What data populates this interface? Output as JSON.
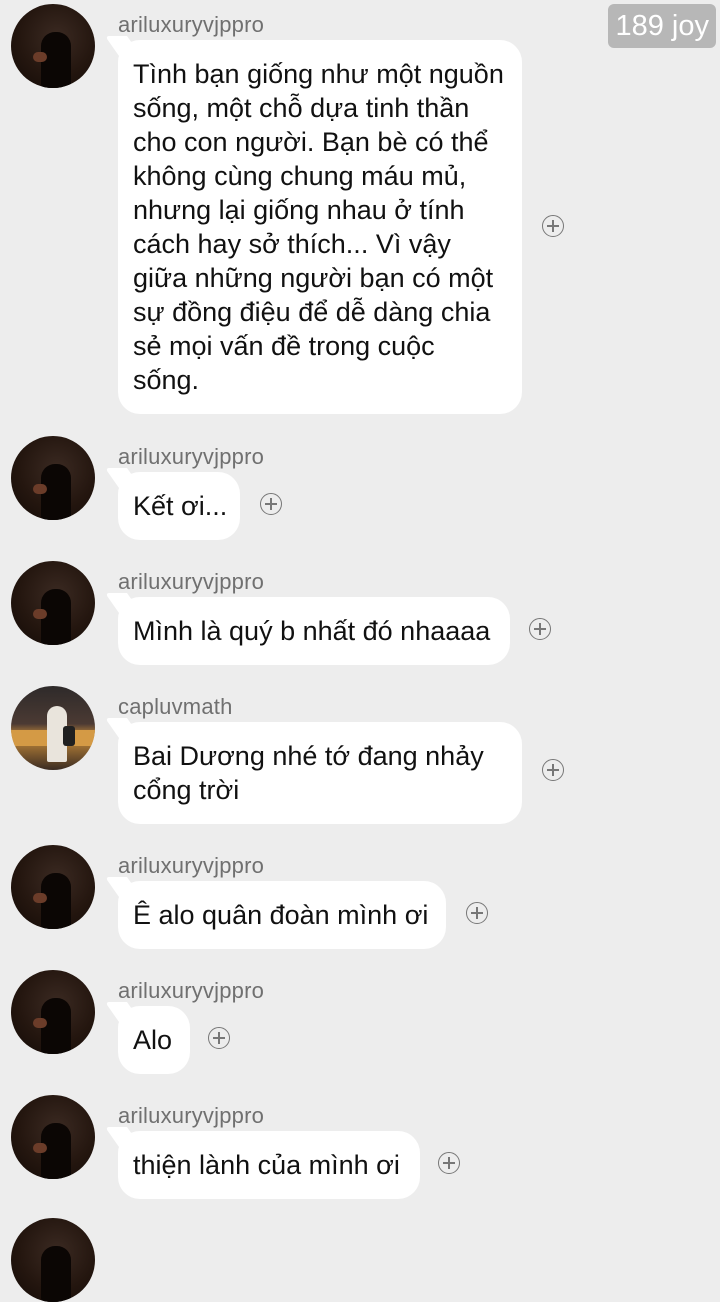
{
  "watermark": {
    "text": "189 joy"
  },
  "messages": [
    {
      "username": "ariluxuryvjppro",
      "avatar": "dark-portrait-avatar",
      "text": "Tình bạn giống như một nguồn sống, một chỗ dựa tinh thần cho con người. Bạn bè có thể không cùng chung máu mủ, nhưng lại giống nhau ở tính cách hay sở thích... Vì vậy giữa những người bạn có một sự đồng điệu để dễ dàng chia sẻ mọi vấn đề trong cuộc sống."
    },
    {
      "username": "ariluxuryvjppro",
      "avatar": "dark-portrait-avatar",
      "text": "Kết ơi..."
    },
    {
      "username": "ariluxuryvjppro",
      "avatar": "dark-portrait-avatar",
      "text": "Mình là quý b nhất đó nhaaaa"
    },
    {
      "username": "capluvmath",
      "avatar": "bakery-photo-avatar",
      "text": "Bai Dương nhé tớ đang nhảy cổng trời"
    },
    {
      "username": "ariluxuryvjppro",
      "avatar": "dark-portrait-avatar",
      "text": "Ê alo quân đoàn mình ơi"
    },
    {
      "username": "ariluxuryvjppro",
      "avatar": "dark-portrait-avatar",
      "text": "Alo"
    },
    {
      "username": "ariluxuryvjppro",
      "avatar": "dark-portrait-avatar",
      "text": "thiện lành của mình ơi"
    }
  ],
  "icons": {
    "reaction": "add-reaction-icon"
  }
}
